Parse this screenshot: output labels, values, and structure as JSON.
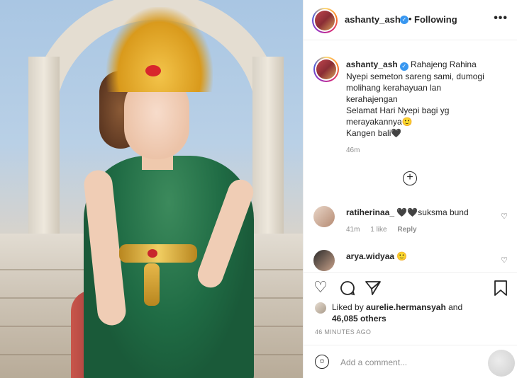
{
  "post": {
    "author": "ashanty_ash",
    "follow_status": "Following",
    "more_icon": "more-options-icon"
  },
  "caption": {
    "author": "ashanty_ash",
    "lines": [
      "Rahajeng Rahina",
      "Nyepi semeton sareng sami, dumogi",
      "molihang kerahayuan lan",
      "kerahajengan",
      "Selamat Hari Nyepi bagi yg",
      "merayakannya🙂",
      "Kangen bali🖤"
    ],
    "time": "46m"
  },
  "comments": [
    {
      "author": "ratiherinaa_",
      "text": "🖤🖤suksma bund",
      "time": "41m",
      "likes": "1 like",
      "reply": "Reply"
    },
    {
      "author": "arya.widyaa",
      "text": "🙂"
    }
  ],
  "likes": {
    "prefix": "Liked by",
    "first_user": "aurelie.hermansyah",
    "conjunction": "and",
    "others": "46,085 others"
  },
  "timestamp": "46 MINUTES AGO",
  "add_comment": {
    "placeholder": "Add a comment..."
  },
  "colors": {
    "verified": "#3897f0",
    "muted": "#8e8e8e",
    "text": "#262626"
  }
}
